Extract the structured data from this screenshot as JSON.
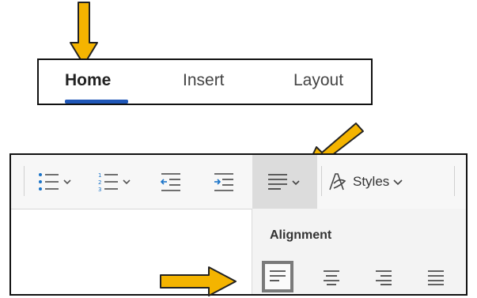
{
  "tabs": {
    "items": [
      {
        "label": "Home",
        "selected": true
      },
      {
        "label": "Insert",
        "selected": false
      },
      {
        "label": "Layout",
        "selected": false
      }
    ]
  },
  "toolbar": {
    "styles_label": "Styles",
    "buttons": [
      "bullets-list",
      "numbered-list",
      "decrease-indent",
      "increase-indent",
      "alignment",
      "styles"
    ]
  },
  "alignment_menu": {
    "title": "Alignment",
    "options": [
      "align-left",
      "align-center",
      "align-right",
      "justify"
    ],
    "selected": "align-left"
  },
  "colors": {
    "arrow": "#f4b400",
    "tab_underline": "#1f57b8",
    "list_icon": "#1a73c8"
  }
}
